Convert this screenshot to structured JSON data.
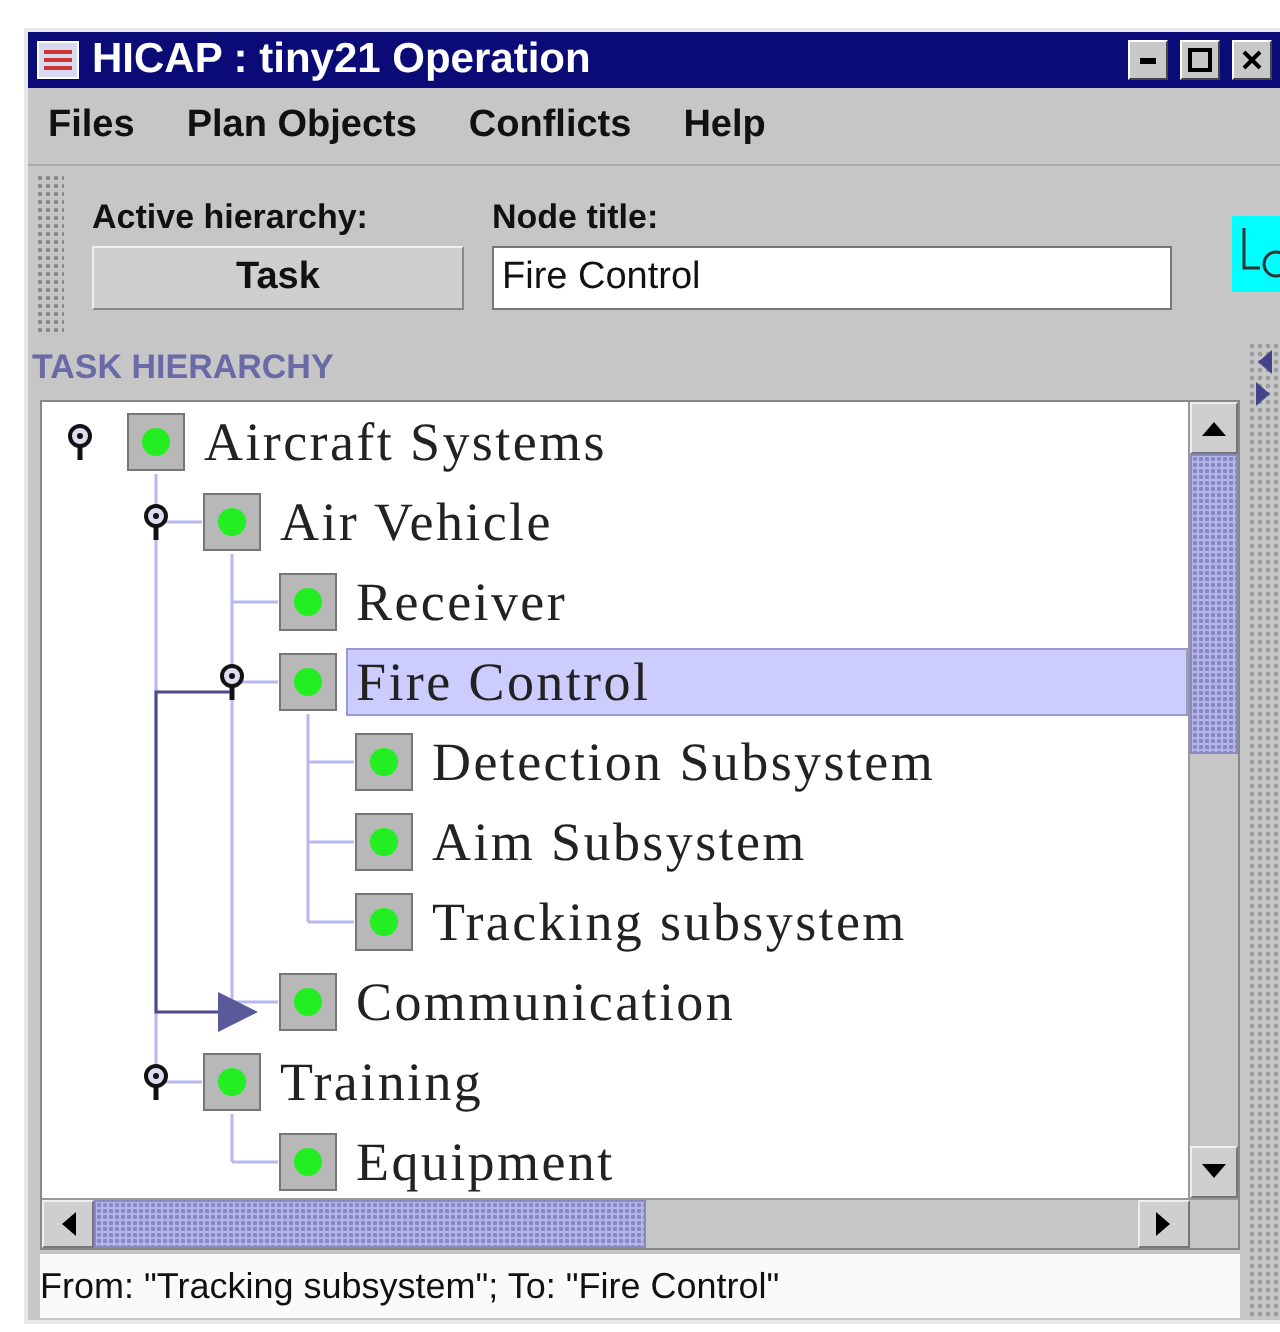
{
  "window": {
    "title": "HICAP : tiny21 Operation"
  },
  "menu": [
    "Files",
    "Plan Objects",
    "Conflicts",
    "Help"
  ],
  "toolbar": {
    "active_hierarchy_label": "Active hierarchy:",
    "active_hierarchy_button": "Task",
    "node_title_label": "Node title:",
    "node_title_value": "Fire Control"
  },
  "tree": {
    "header": "TASK HIERARCHY",
    "nodes": [
      {
        "label": "Aircraft Systems",
        "expanded": true,
        "selected": false,
        "children": [
          {
            "label": "Air Vehicle",
            "expanded": true,
            "selected": false,
            "children": [
              {
                "label": "Receiver",
                "selected": false
              },
              {
                "label": "Fire Control",
                "expanded": true,
                "selected": true,
                "children": [
                  {
                    "label": "Detection Subsystem",
                    "selected": false
                  },
                  {
                    "label": "Aim Subsystem",
                    "selected": false
                  },
                  {
                    "label": "Tracking subsystem",
                    "selected": false
                  }
                ]
              },
              {
                "label": "Communication",
                "selected": false
              }
            ]
          },
          {
            "label": "Training",
            "expanded": true,
            "selected": false,
            "children": [
              {
                "label": "Equipment",
                "selected": false
              }
            ]
          }
        ]
      }
    ]
  },
  "status": "From: \"Tracking subsystem\"; To: \"Fire Control\""
}
